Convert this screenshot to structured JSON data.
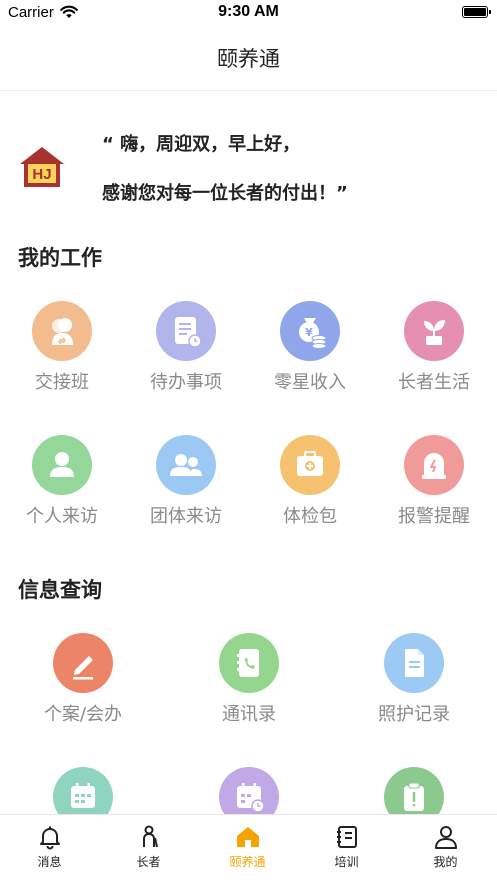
{
  "status_bar": {
    "carrier": "Carrier",
    "time": "9:30 AM"
  },
  "nav": {
    "title": "颐养通"
  },
  "greeting": {
    "line1": "“ 嗨，周迎双，早上好，",
    "line2": "感谢您对每一位长者的付出！”",
    "logo_text": "HJ"
  },
  "work": {
    "title": "我的工作",
    "items": [
      {
        "label": "交接班",
        "icon": "handover-icon",
        "color": "#f3bc8f"
      },
      {
        "label": "待办事项",
        "icon": "todo-icon",
        "color": "#b2b4ec"
      },
      {
        "label": "零星收入",
        "icon": "money-bag-icon",
        "color": "#8fa6ea"
      },
      {
        "label": "长者生活",
        "icon": "plant-icon",
        "color": "#e58fb3"
      },
      {
        "label": "个人来访",
        "icon": "person-icon",
        "color": "#95d79a"
      },
      {
        "label": "团体来访",
        "icon": "group-icon",
        "color": "#9cc9f3"
      },
      {
        "label": "体检包",
        "icon": "medical-kit-icon",
        "color": "#f6c26f"
      },
      {
        "label": "报警提醒",
        "icon": "alarm-icon",
        "color": "#f19a9a"
      }
    ]
  },
  "info": {
    "title": "信息查询",
    "items": [
      {
        "label": "个案/会办",
        "icon": "edit-icon",
        "color": "#ec8467"
      },
      {
        "label": "通讯录",
        "icon": "contacts-icon",
        "color": "#95d68e"
      },
      {
        "label": "照护记录",
        "icon": "document-icon",
        "color": "#9ccaf4"
      },
      {
        "label": "",
        "icon": "calendar-icon",
        "color": "#8ed4be"
      },
      {
        "label": "",
        "icon": "calendar-clock-icon",
        "color": "#c1a8e6"
      },
      {
        "label": "",
        "icon": "clipboard-alert-icon",
        "color": "#8cc98e"
      }
    ]
  },
  "tabs": [
    {
      "label": "消息",
      "icon": "bell-icon"
    },
    {
      "label": "长者",
      "icon": "elder-icon"
    },
    {
      "label": "颐养通",
      "icon": "home-icon",
      "active": true
    },
    {
      "label": "培训",
      "icon": "notebook-icon"
    },
    {
      "label": "我的",
      "icon": "profile-icon"
    }
  ],
  "colors": {
    "accent": "#f5a300",
    "logo": "#a8322e"
  }
}
